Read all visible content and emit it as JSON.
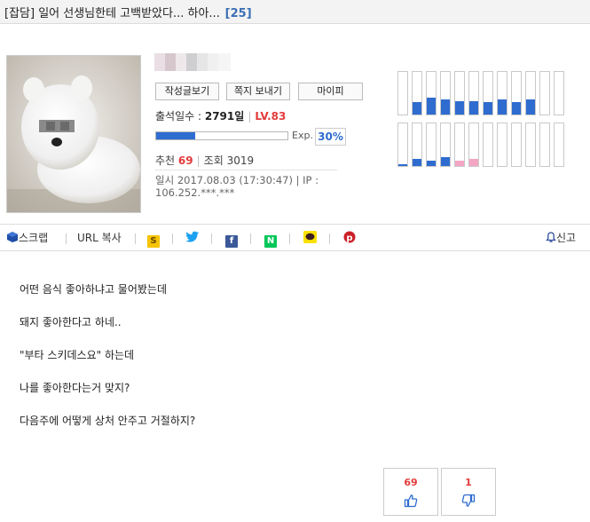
{
  "title": {
    "text": "[잡담] 일어 선생님한테 고백받았다... 하아...",
    "comment_count": "[25]"
  },
  "profile": {
    "buttons": {
      "posts": "작성글보기",
      "message": "쪽지 보내기",
      "mypi": "마이피"
    },
    "attendance_label": "출석일수 :",
    "attendance_value": "2791일",
    "level": "LV.83",
    "exp_label": "Exp.",
    "exp_percent": "30%",
    "exp_fraction": 0.3,
    "recommend_label": "추천",
    "recommend_value": "69",
    "views_label": "조회 3019",
    "date_line": "일시 2017.08.03 (17:30:47) | IP : 106.252.***.***"
  },
  "activity_bars": {
    "color_blue": "#2f6ccf",
    "color_pink": "#f3a6c3",
    "top_levels": [
      0.0,
      0.3,
      0.4,
      0.36,
      0.32,
      0.32,
      0.3,
      0.36,
      0.3,
      0.36,
      0.0,
      0.0
    ],
    "bottom_levels": [
      0.04,
      0.16,
      0.12,
      0.2,
      0.12,
      0.16,
      0.0,
      0.0,
      0.0,
      0.0,
      0.0,
      0.0
    ],
    "bottom_colors": [
      "blue",
      "blue",
      "blue",
      "blue",
      "pink",
      "pink",
      "blue",
      "blue",
      "blue",
      "blue",
      "blue",
      "blue"
    ]
  },
  "share": {
    "scrap": "스크랩",
    "url_copy": "URL 복사",
    "report": "신고",
    "icons": [
      "kakaostory-icon",
      "twitter-icon",
      "facebook-icon",
      "naver-icon",
      "kakaotalk-icon",
      "pinterest-icon"
    ]
  },
  "content": {
    "lines": [
      "어떤 음식 좋아하냐고 물어봤는데",
      "돼지 좋아한다고 하네..",
      "\"부타 스키데스요\" 하는데",
      "나를 좋아한다는거 맞지?",
      "다음주에 어떻게 상처 안주고 거절하지?"
    ]
  },
  "votes": {
    "up": "69",
    "down": "1"
  }
}
